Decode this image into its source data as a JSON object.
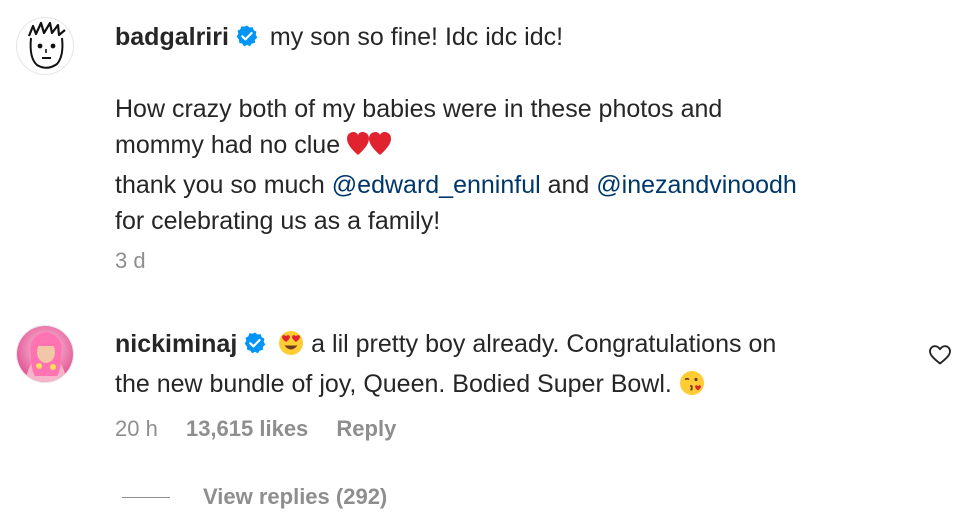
{
  "comments": [
    {
      "username": "badgalriri",
      "first_line": "my son so fine! Idc idc idc!",
      "para_line1": "How crazy both of my babies were in these photos and",
      "para_line2": "mommy had no clue",
      "thanks_before": "thank you so much",
      "mention1": "@edward_enninful",
      "thanks_middle": "and",
      "mention2": "@inezandvinoodh",
      "last_line": "for celebrating us as a family!",
      "time": "3 d"
    },
    {
      "username": "nickiminaj",
      "line1": "a lil pretty boy already. Congratulations on",
      "line2": "the new bundle of joy, Queen. Bodied Super Bowl.",
      "time": "20 h",
      "likes": "13,615 likes",
      "reply_label": "Reply",
      "view_replies": "View replies (292)"
    }
  ],
  "icons": {
    "verified": "verified-badge-icon",
    "heart": "heart-outline-icon",
    "emoji_hearts": "red-heart-emoji",
    "emoji_heart_eyes": "heart-eyes-emoji",
    "emoji_kiss": "face-blowing-kiss-emoji"
  },
  "colors": {
    "text": "#262626",
    "secondary": "#8e8e8e",
    "mention": "#00376b",
    "verified": "#0095f6"
  }
}
